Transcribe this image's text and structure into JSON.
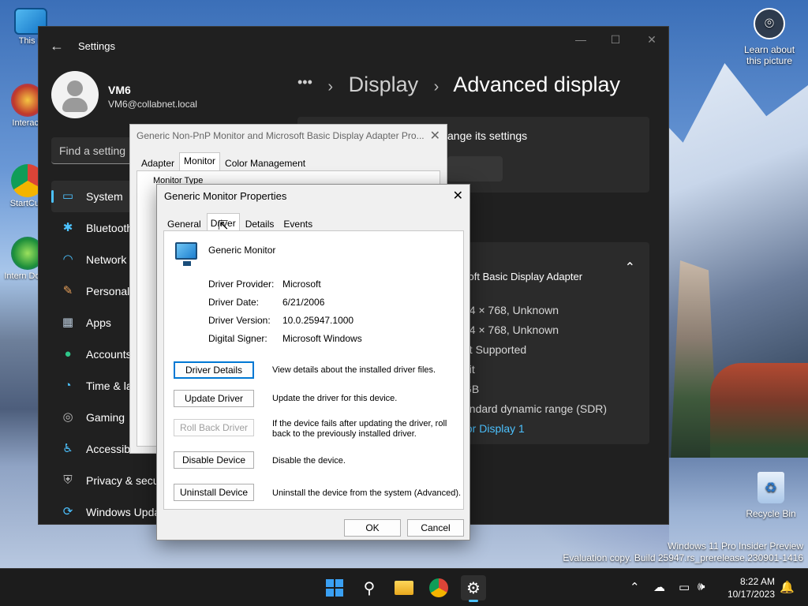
{
  "desktop": {
    "icons": [
      {
        "label": "This F",
        "name": "this-pc"
      },
      {
        "label": "Interacti",
        "name": "interactive"
      },
      {
        "label": "StartCurr",
        "name": "startcurr"
      },
      {
        "label": "Intern Down",
        "name": "internet-download"
      }
    ],
    "learn_label": "Learn about this picture",
    "recycle_label": "Recycle Bin",
    "watermark_line1": "Windows 11 Pro Insider Preview",
    "watermark_line2": "Evaluation copy. Build 25947.rs_prerelease.230901-1416"
  },
  "settings": {
    "title": "Settings",
    "user_name": "VM6",
    "user_email": "VM6@collabnet.local",
    "search_placeholder": "Find a setting",
    "nav": [
      {
        "label": "System",
        "icon": "monitor-icon",
        "glyph": "▭"
      },
      {
        "label": "Bluetooth",
        "icon": "bluetooth-icon",
        "glyph": "✱"
      },
      {
        "label": "Network",
        "icon": "wifi-icon",
        "glyph": "◠"
      },
      {
        "label": "Personaliz",
        "icon": "brush-icon",
        "glyph": "✎"
      },
      {
        "label": "Apps",
        "icon": "apps-icon",
        "glyph": "▦"
      },
      {
        "label": "Accounts",
        "icon": "person-icon",
        "glyph": "●"
      },
      {
        "label": "Time & la",
        "icon": "globe-clock-icon",
        "glyph": "◔"
      },
      {
        "label": "Gaming",
        "icon": "gamepad-icon",
        "glyph": "◎"
      },
      {
        "label": "Accessibil",
        "icon": "accessibility-icon",
        "glyph": "♿"
      },
      {
        "label": "Privacy & secu",
        "icon": "shield-icon",
        "glyph": "⛨"
      },
      {
        "label": "Windows Upda",
        "icon": "update-icon",
        "glyph": "⟳"
      }
    ],
    "breadcrumb_ellipsis": "•••",
    "breadcrumb_parent": "Display",
    "breadcrumb_current": "Advanced display",
    "card1_text": "ange its settings",
    "adapter_text": "soft Basic Display Adapter",
    "info_rows": [
      "24 × 768, Unknown",
      "24 × 768, Unknown",
      "ot Supported",
      "bit",
      "GB",
      "andard dynamic range (SDR)"
    ],
    "info_link": "for Display 1"
  },
  "props_back": {
    "title": "Generic Non-PnP Monitor and Microsoft Basic Display Adapter Pro...",
    "tabs": [
      "Adapter",
      "Monitor",
      "Color Management"
    ],
    "group_label": "Monitor Type"
  },
  "dialog": {
    "title": "Generic Monitor Properties",
    "tabs": [
      "General",
      "Driver",
      "Details",
      "Events"
    ],
    "device_name": "Generic Monitor",
    "labels": [
      "Driver Provider:",
      "Driver Date:",
      "Driver Version:",
      "Digital Signer:"
    ],
    "values": [
      "Microsoft",
      "6/21/2006",
      "10.0.25947.1000",
      "Microsoft Windows"
    ],
    "buttons": [
      {
        "label": "Driver Details",
        "desc": "View details about the installed driver files."
      },
      {
        "label": "Update Driver",
        "desc": "Update the driver for this device."
      },
      {
        "label": "Roll Back Driver",
        "desc": "If the device fails after updating the driver, roll back to the previously installed driver."
      },
      {
        "label": "Disable Device",
        "desc": "Disable the device."
      },
      {
        "label": "Uninstall Device",
        "desc": "Uninstall the device from the system (Advanced)."
      }
    ],
    "ok_label": "OK",
    "cancel_label": "Cancel"
  },
  "taskbar": {
    "time": "8:22 AM",
    "date": "10/17/2023"
  }
}
